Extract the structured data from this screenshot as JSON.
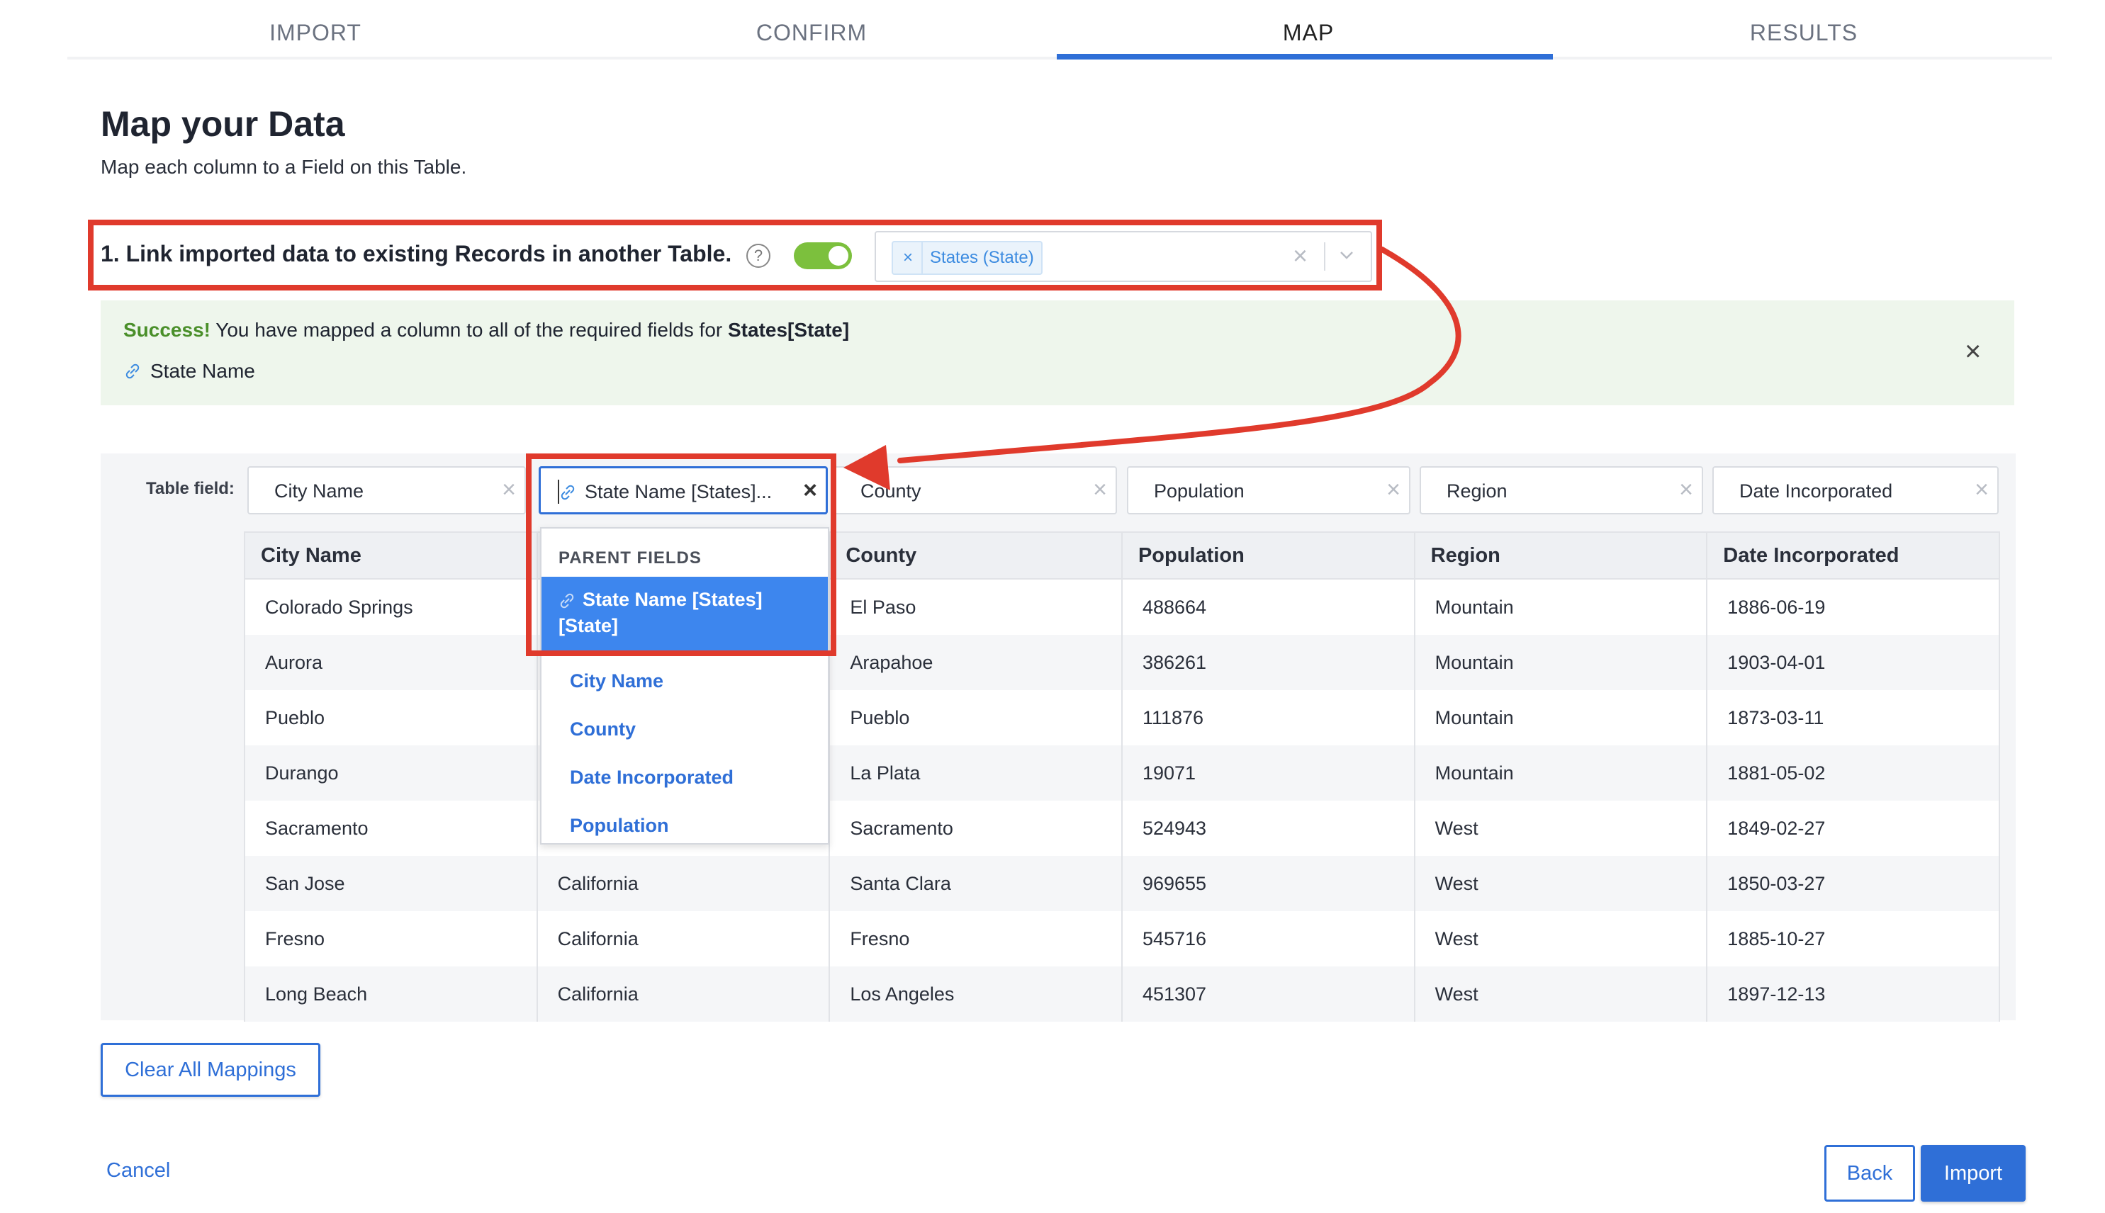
{
  "stepper": {
    "steps": [
      "IMPORT",
      "CONFIRM",
      "MAP",
      "RESULTS"
    ],
    "active": "MAP"
  },
  "header": {
    "title": "Map your Data",
    "subtitle": "Map each column to a Field on this Table."
  },
  "link_section": {
    "label": "1. Link imported data to existing Records in another Table.",
    "toggle_on": true,
    "selected_chip": "States (State)",
    "chip_remove": "×",
    "clear_icon": "×"
  },
  "banner": {
    "success_word": "Success!",
    "message": " You have mapped a column to all of the required fields for ",
    "table_ref": "States[State]",
    "mapped_field": "State Name",
    "close_icon": "×"
  },
  "mapping": {
    "table_field_label": "Table field:",
    "selectors": [
      {
        "value": "City Name"
      },
      {
        "value": "State Name [States]..."
      },
      {
        "value": "County"
      },
      {
        "value": "Population"
      },
      {
        "value": "Region"
      },
      {
        "value": "Date Incorporated"
      }
    ],
    "clear_icon": "×"
  },
  "dropdown": {
    "header": "PARENT FIELDS",
    "selected": "State Name [States] [State]",
    "items": [
      "City Name",
      "County",
      "Date Incorporated",
      "Population"
    ]
  },
  "table": {
    "columns": [
      "City Name",
      "",
      "County",
      "Population",
      "Region",
      "Date Incorporated"
    ],
    "rows": [
      [
        "Colorado Springs",
        "",
        "El Paso",
        "488664",
        "Mountain",
        "1886-06-19"
      ],
      [
        "Aurora",
        "",
        "Arapahoe",
        "386261",
        "Mountain",
        "1903-04-01"
      ],
      [
        "Pueblo",
        "",
        "Pueblo",
        "111876",
        "Mountain",
        "1873-03-11"
      ],
      [
        "Durango",
        "",
        "La Plata",
        "19071",
        "Mountain",
        "1881-05-02"
      ],
      [
        "Sacramento",
        "",
        "Sacramento",
        "524943",
        "West",
        "1849-02-27"
      ],
      [
        "San Jose",
        "California",
        "Santa Clara",
        "969655",
        "West",
        "1850-03-27"
      ],
      [
        "Fresno",
        "California",
        "Fresno",
        "545716",
        "West",
        "1885-10-27"
      ],
      [
        "Long Beach",
        "California",
        "Los Angeles",
        "451307",
        "West",
        "1897-12-13"
      ]
    ]
  },
  "buttons": {
    "clear_all": "Clear All Mappings",
    "cancel": "Cancel",
    "back": "Back",
    "import": "Import"
  },
  "colors": {
    "accent": "#2f6fd7",
    "annotation_red": "#e03a2c",
    "toggle_green": "#7cc03d",
    "success_green": "#4a8f2a",
    "banner_bg": "#eef6ec"
  }
}
